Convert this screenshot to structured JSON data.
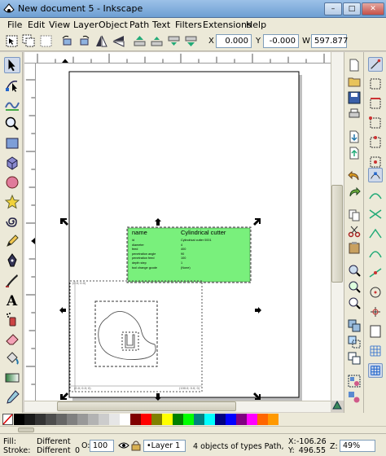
{
  "window": {
    "title": "New document 5 - Inkscape",
    "minimize": "–",
    "maximize": "□",
    "close": "✕"
  },
  "menu": [
    {
      "label": "File"
    },
    {
      "label": "Edit"
    },
    {
      "label": "View"
    },
    {
      "label": "Layer"
    },
    {
      "label": "Object"
    },
    {
      "label": "Path"
    },
    {
      "label": "Text"
    },
    {
      "label": "Filters"
    },
    {
      "label": "Extensions"
    },
    {
      "label": "Help"
    }
  ],
  "toolbar": {
    "x_label": "X",
    "x_value": "0.000",
    "y_label": "Y",
    "y_value": "-0.000",
    "w_label": "W",
    "w_value": "597.877"
  },
  "canvas": {
    "info_box": {
      "header_left": "name",
      "header_right": "Cylindrical cutter",
      "rows": [
        {
          "k": "id",
          "v": "Cylindrical cutter 0001"
        },
        {
          "k": "diameter",
          "v": "4"
        },
        {
          "k": "feed",
          "v": "400"
        },
        {
          "k": "penetration angle",
          "v": "90"
        },
        {
          "k": "penetration feed",
          "v": "100"
        },
        {
          "k": "depth step",
          "v": "1"
        },
        {
          "k": "tool change gcode",
          "v": "(None)"
        }
      ]
    },
    "corner_labels": {
      "top_left": "(0.0; 0.0)",
      "bottom_left": "(0.0; 0.0; 0)",
      "bottom_right": "(100.0; 0.0; 0)"
    }
  },
  "palette": {
    "colors": [
      "#000000",
      "#1a1a1a",
      "#333333",
      "#4d4d4d",
      "#666666",
      "#808080",
      "#999999",
      "#b3b3b3",
      "#cccccc",
      "#e6e6e6",
      "#ffffff",
      "#800000",
      "#ff0000",
      "#808000",
      "#ffff00",
      "#008000",
      "#00ff00",
      "#008080",
      "#00ffff",
      "#000080",
      "#0000ff",
      "#800080",
      "#ff00ff",
      "#ff6600",
      "#ff9900"
    ]
  },
  "status": {
    "fill_label": "Fill:",
    "fill_value": "Different",
    "stroke_label": "Stroke:",
    "stroke_value": "Different",
    "stroke_width": "0",
    "opacity_label": "O:",
    "opacity_value": "100",
    "layer": "•Layer 1",
    "message": "4 objects of types Path, Gro",
    "x_label": "X:",
    "x_value": "-106.26",
    "y_label": "Y:",
    "y_value": "496.55",
    "zoom_label": "Z:",
    "zoom_value": "49%"
  }
}
